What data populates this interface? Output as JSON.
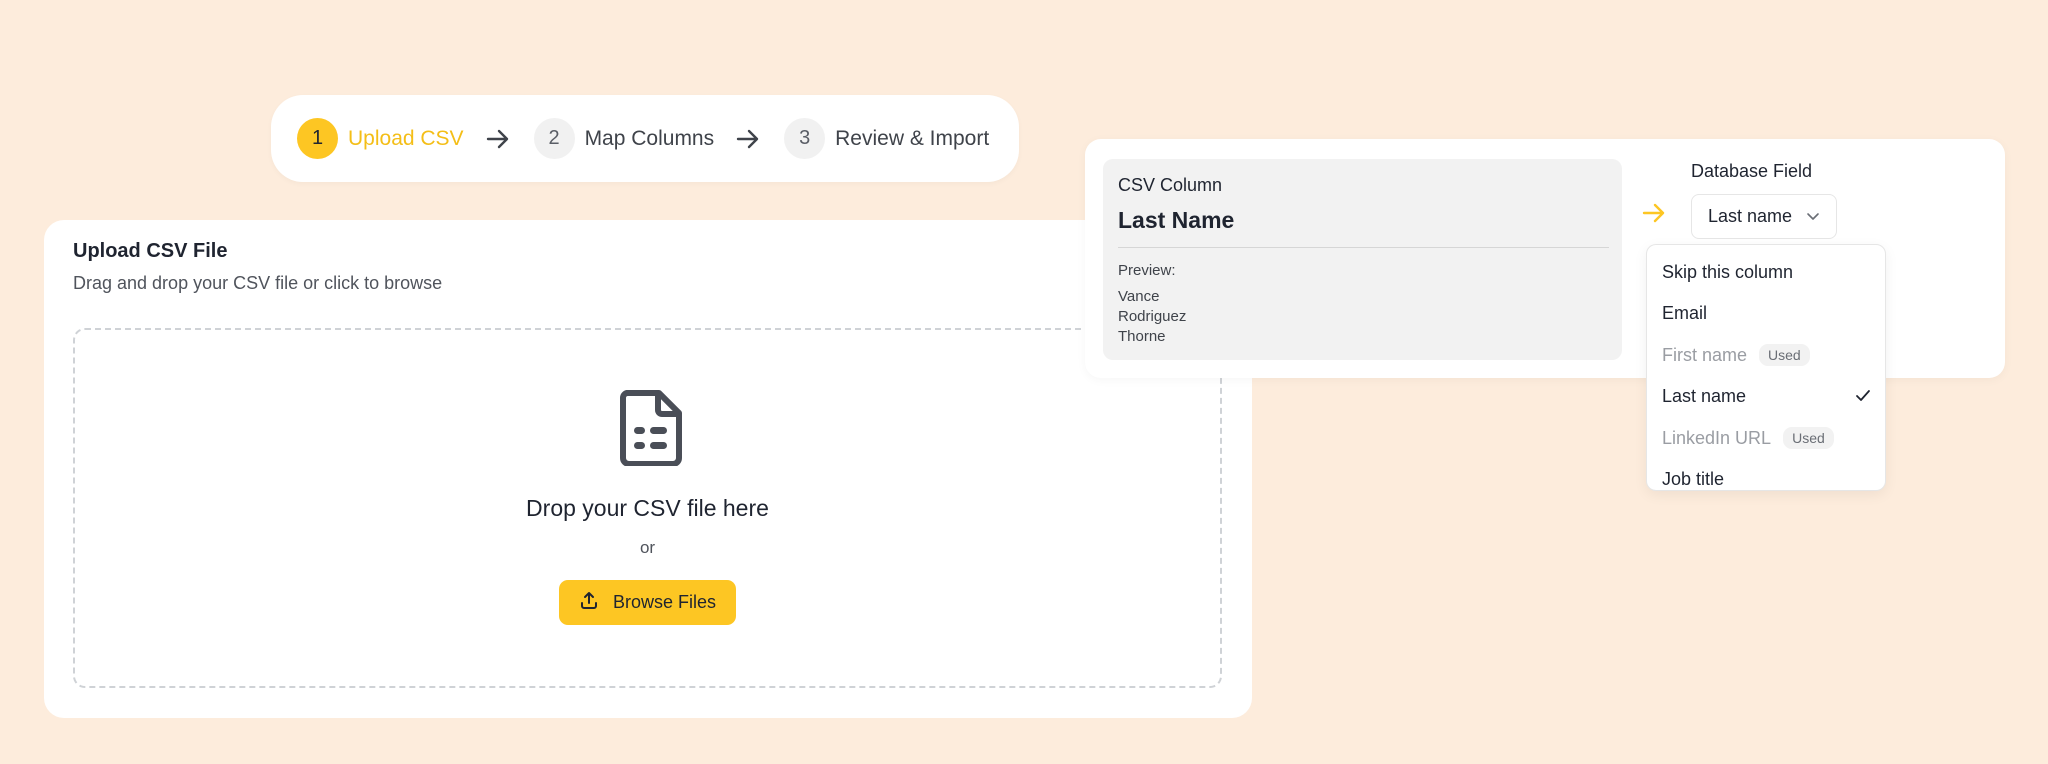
{
  "stepper": {
    "steps": [
      {
        "num": "1",
        "label": "Upload CSV"
      },
      {
        "num": "2",
        "label": "Map Columns"
      },
      {
        "num": "3",
        "label": "Review & Import"
      }
    ]
  },
  "upload": {
    "title": "Upload CSV File",
    "subtitle": "Drag and drop your CSV file or click to browse",
    "drop_text": "Drop your CSV file here",
    "or_text": "or",
    "browse_label": "Browse Files"
  },
  "mapping": {
    "csv_column_label": "CSV Column",
    "csv_column_name": "Last Name",
    "preview_label": "Preview:",
    "preview_values": [
      "Vance",
      "Rodriguez",
      "Thorne"
    ],
    "db_field_label": "Database Field",
    "selected_field": "Last name"
  },
  "dropdown": {
    "options": [
      {
        "label": "Skip this column"
      },
      {
        "label": "Email"
      },
      {
        "label": "First name",
        "badge": "Used"
      },
      {
        "label": "Last name"
      },
      {
        "label": "LinkedIn URL",
        "badge": "Used"
      },
      {
        "label": "Job title"
      }
    ]
  },
  "colors": {
    "accent": "#fdc623",
    "background": "#fdecdc"
  }
}
